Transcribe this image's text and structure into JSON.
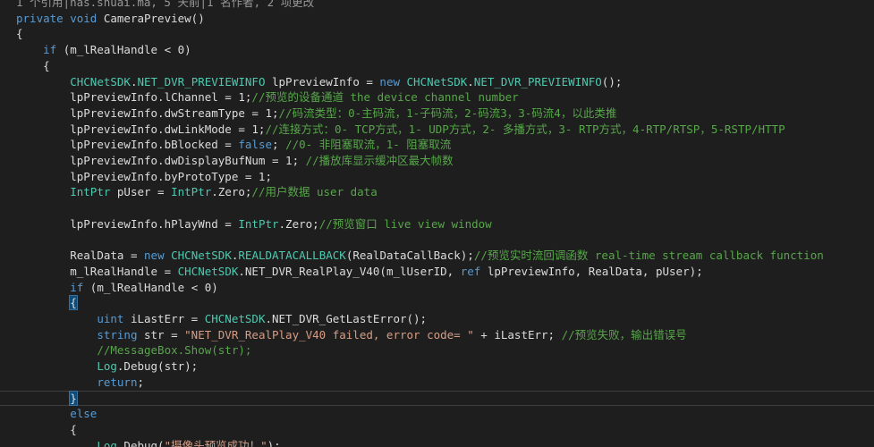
{
  "editor": {
    "colors": {
      "background": "#1e1e1e",
      "keyword": "#569cd6",
      "type": "#4ec9b0",
      "string": "#d69d85",
      "comment": "#57a64a",
      "plain": "#dcdcdc",
      "codelens": "#999999"
    },
    "lines": [
      {
        "indent": "",
        "tokens": [
          {
            "t": "1 个引用|nas.shuai.ma, 5 天前|1 名作者, 2 项更改",
            "c": "lens"
          }
        ]
      },
      {
        "indent": "",
        "tokens": [
          {
            "t": "private",
            "c": "kw"
          },
          {
            "t": " "
          },
          {
            "t": "void",
            "c": "kw"
          },
          {
            "t": " CameraPreview()"
          }
        ]
      },
      {
        "indent": "",
        "tokens": [
          {
            "t": "{"
          }
        ]
      },
      {
        "indent": "    ",
        "tokens": [
          {
            "t": "if",
            "c": "kw"
          },
          {
            "t": " (m_lRealHandle < 0)"
          }
        ]
      },
      {
        "indent": "    ",
        "tokens": [
          {
            "t": "{"
          }
        ]
      },
      {
        "indent": "        ",
        "tokens": [
          {
            "t": "CHCNetSDK",
            "c": "type"
          },
          {
            "t": "."
          },
          {
            "t": "NET_DVR_PREVIEWINFO",
            "c": "type"
          },
          {
            "t": " lpPreviewInfo = "
          },
          {
            "t": "new",
            "c": "kw"
          },
          {
            "t": " "
          },
          {
            "t": "CHCNetSDK",
            "c": "type"
          },
          {
            "t": "."
          },
          {
            "t": "NET_DVR_PREVIEWINFO",
            "c": "type"
          },
          {
            "t": "();"
          }
        ]
      },
      {
        "indent": "        ",
        "tokens": [
          {
            "t": "lpPreviewInfo.lChannel = 1;"
          },
          {
            "t": "//预览的设备通道 the device channel number",
            "c": "cm"
          }
        ]
      },
      {
        "indent": "        ",
        "tokens": [
          {
            "t": "lpPreviewInfo.dwStreamType = 1;"
          },
          {
            "t": "//码流类型：0-主码流，1-子码流，2-码流3，3-码流4，以此类推",
            "c": "cm"
          }
        ]
      },
      {
        "indent": "        ",
        "tokens": [
          {
            "t": "lpPreviewInfo.dwLinkMode = 1;"
          },
          {
            "t": "//连接方式：0- TCP方式，1- UDP方式，2- 多播方式，3- RTP方式，4-RTP/RTSP，5-RSTP/HTTP",
            "c": "cm"
          }
        ]
      },
      {
        "indent": "        ",
        "tokens": [
          {
            "t": "lpPreviewInfo.bBlocked = "
          },
          {
            "t": "false",
            "c": "kw"
          },
          {
            "t": "; "
          },
          {
            "t": "//0- 非阻塞取流，1- 阻塞取流",
            "c": "cm"
          }
        ]
      },
      {
        "indent": "        ",
        "tokens": [
          {
            "t": "lpPreviewInfo.dwDisplayBufNum = 1; "
          },
          {
            "t": "//播放库显示缓冲区最大帧数",
            "c": "cm"
          }
        ]
      },
      {
        "indent": "        ",
        "tokens": [
          {
            "t": "lpPreviewInfo.byProtoType = 1;"
          }
        ]
      },
      {
        "indent": "        ",
        "tokens": [
          {
            "t": "IntPtr",
            "c": "type"
          },
          {
            "t": " pUser = "
          },
          {
            "t": "IntPtr",
            "c": "type"
          },
          {
            "t": ".Zero;"
          },
          {
            "t": "//用户数据 user data",
            "c": "cm"
          }
        ]
      },
      {
        "indent": "",
        "tokens": []
      },
      {
        "indent": "        ",
        "tokens": [
          {
            "t": "lpPreviewInfo.hPlayWnd = "
          },
          {
            "t": "IntPtr",
            "c": "type"
          },
          {
            "t": ".Zero;"
          },
          {
            "t": "//预览窗口 live view window",
            "c": "cm"
          }
        ]
      },
      {
        "indent": "",
        "tokens": []
      },
      {
        "indent": "        ",
        "tokens": [
          {
            "t": "RealData = "
          },
          {
            "t": "new",
            "c": "kw"
          },
          {
            "t": " "
          },
          {
            "t": "CHCNetSDK",
            "c": "type"
          },
          {
            "t": "."
          },
          {
            "t": "REALDATACALLBACK",
            "c": "type"
          },
          {
            "t": "(RealDataCallBack);"
          },
          {
            "t": "//预览实时流回调函数 real-time stream callback function",
            "c": "cm"
          }
        ]
      },
      {
        "indent": "        ",
        "tokens": [
          {
            "t": "m_lRealHandle = "
          },
          {
            "t": "CHCNetSDK",
            "c": "type"
          },
          {
            "t": ".NET_DVR_RealPlay_V40(m_lUserID, "
          },
          {
            "t": "ref",
            "c": "kw"
          },
          {
            "t": " lpPreviewInfo, RealData, pUser);"
          }
        ]
      },
      {
        "indent": "        ",
        "tokens": [
          {
            "t": "if",
            "c": "kw"
          },
          {
            "t": " (m_lRealHandle < 0)"
          }
        ]
      },
      {
        "indent": "        ",
        "tokens": [
          {
            "t": "{",
            "c": "bracehl"
          }
        ]
      },
      {
        "indent": "            ",
        "tokens": [
          {
            "t": "uint",
            "c": "kw"
          },
          {
            "t": " iLastErr = "
          },
          {
            "t": "CHCNetSDK",
            "c": "type"
          },
          {
            "t": ".NET_DVR_GetLastError();"
          }
        ]
      },
      {
        "indent": "            ",
        "tokens": [
          {
            "t": "string",
            "c": "kw"
          },
          {
            "t": " str = "
          },
          {
            "t": "\"NET_DVR_RealPlay_V40 failed, error code= \"",
            "c": "str"
          },
          {
            "t": " + iLastErr; "
          },
          {
            "t": "//预览失败，输出错误号",
            "c": "cm"
          }
        ]
      },
      {
        "indent": "            ",
        "tokens": [
          {
            "t": "//MessageBox.Show(str);",
            "c": "cm"
          }
        ]
      },
      {
        "indent": "            ",
        "tokens": [
          {
            "t": "Log",
            "c": "type"
          },
          {
            "t": ".Debug(str);"
          }
        ]
      },
      {
        "indent": "            ",
        "tokens": [
          {
            "t": "return",
            "c": "kw"
          },
          {
            "t": ";"
          }
        ]
      },
      {
        "indent": "        ",
        "current": true,
        "tokens": [
          {
            "t": "}",
            "c": "bracehl"
          },
          {
            "t": "",
            "c": "caret"
          }
        ]
      },
      {
        "indent": "        ",
        "tokens": [
          {
            "t": "else",
            "c": "kw"
          }
        ]
      },
      {
        "indent": "        ",
        "tokens": [
          {
            "t": "{"
          }
        ]
      },
      {
        "indent": "            ",
        "tokens": [
          {
            "t": "Log",
            "c": "type"
          },
          {
            "t": ".Debug("
          },
          {
            "t": "\"摄像头预览成功！\"",
            "c": "str"
          },
          {
            "t": ");"
          }
        ]
      }
    ]
  }
}
